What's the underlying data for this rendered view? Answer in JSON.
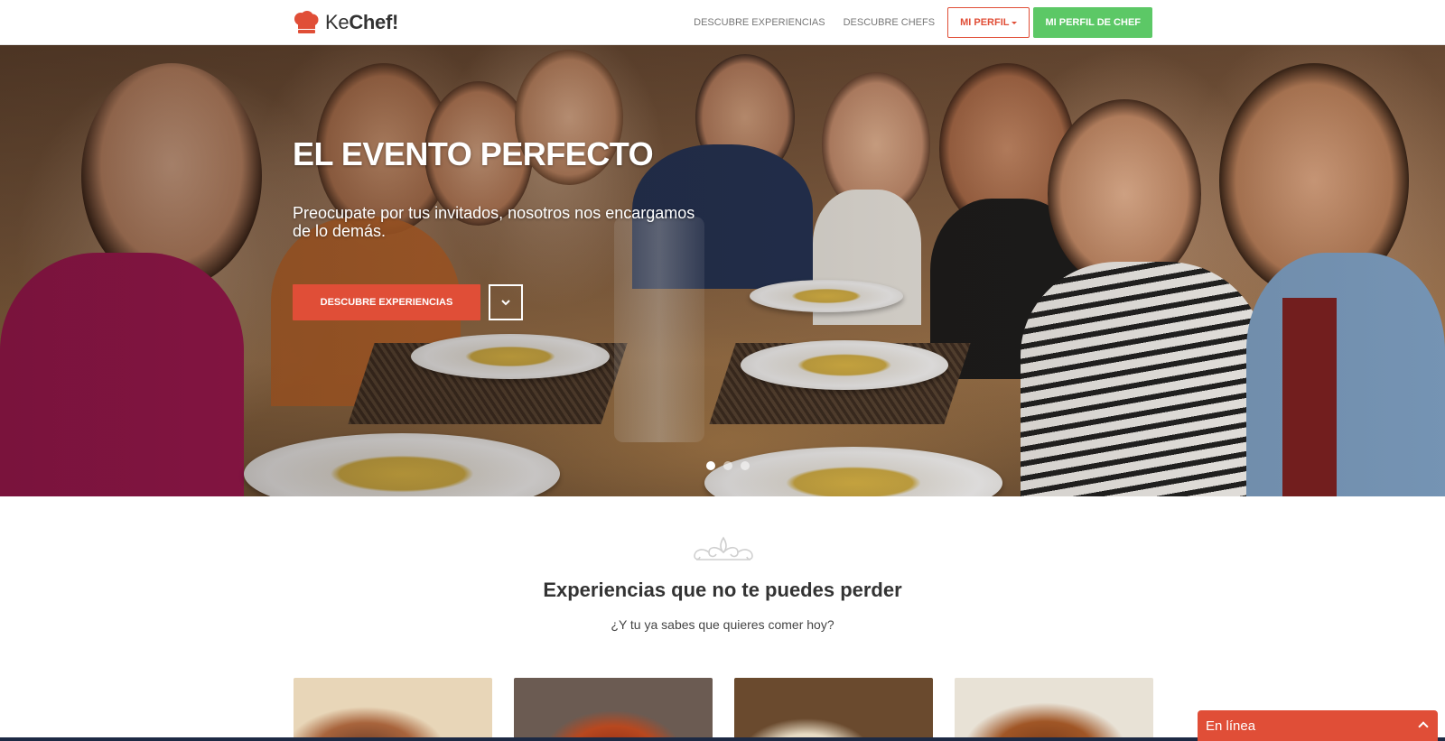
{
  "header": {
    "brand_part1": "Ke",
    "brand_part2": "Chef!",
    "nav": [
      {
        "label": "DESCUBRE EXPERIENCIAS"
      },
      {
        "label": "DESCUBRE CHEFS"
      }
    ],
    "profile_button": "MI PERFIL",
    "chef_profile_button": "MI PERFIL DE CHEF"
  },
  "hero": {
    "title": "EL EVENTO PERFECTO",
    "subtitle": "Preocupate por tus invitados, nosotros nos encargamos de lo demás.",
    "cta": "DESCUBRE EXPERIENCIAS",
    "scroll_icon": "chevron-down-icon",
    "slides_count": 3,
    "active_slide": 1
  },
  "section": {
    "title": "Experiencias que no te puedes perder",
    "subtitle": "¿Y tu ya sabes que quieres comer hoy?"
  },
  "cards": [
    {
      "image": "food-photo-1"
    },
    {
      "image": "food-photo-2"
    },
    {
      "image": "food-photo-3"
    },
    {
      "image": "food-photo-4"
    }
  ],
  "chat": {
    "label": "En línea",
    "icon": "chevron-up-icon"
  },
  "colors": {
    "accent": "#e04e37",
    "green": "#5cc866",
    "text": "#333333"
  }
}
